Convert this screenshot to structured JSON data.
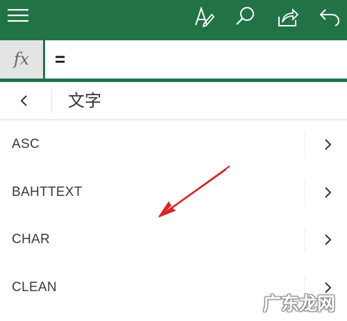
{
  "toolbar": {
    "icons": [
      "hamburger-menu-icon",
      "draw-pen-icon",
      "search-icon",
      "share-icon",
      "undo-icon"
    ]
  },
  "formula_bar": {
    "fx_label": "fx",
    "value": "="
  },
  "category": {
    "title": "文字"
  },
  "functions": [
    {
      "name": "ASC"
    },
    {
      "name": "BAHTTEXT"
    },
    {
      "name": "CHAR"
    },
    {
      "name": "CLEAN"
    }
  ],
  "watermark": {
    "text": "广东龙网"
  },
  "colors": {
    "accent": "#217346",
    "annotation": "#d9252a"
  }
}
